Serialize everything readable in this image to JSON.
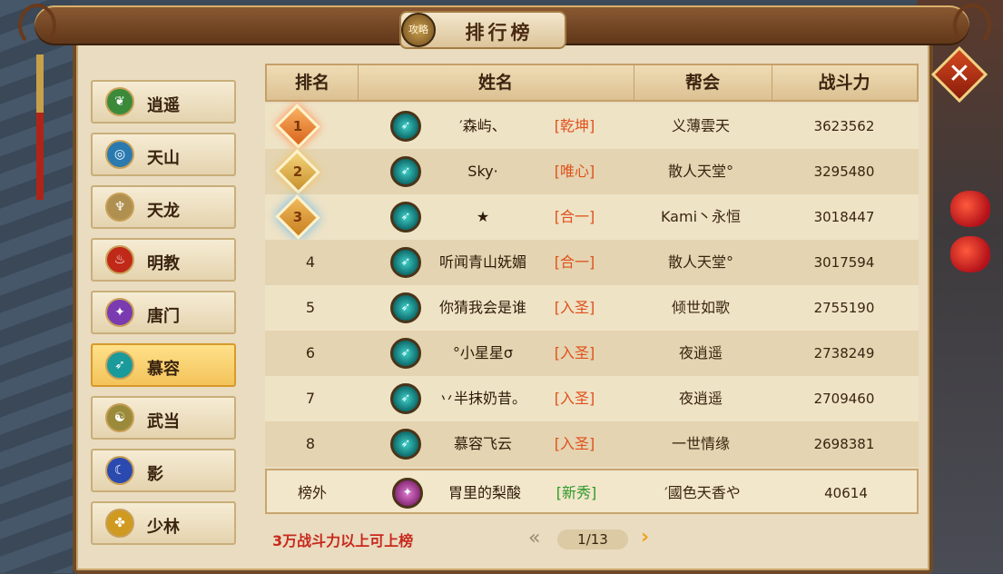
{
  "window": {
    "title": "排行榜",
    "emblem_text": "攻略",
    "close_label": "✕"
  },
  "sidebar": {
    "items": [
      {
        "label": "逍遥",
        "icon": "leaf-icon",
        "active": false
      },
      {
        "label": "天山",
        "icon": "ring-icon",
        "active": false
      },
      {
        "label": "天龙",
        "icon": "dragon-icon",
        "active": false
      },
      {
        "label": "明教",
        "icon": "flame-icon",
        "active": false
      },
      {
        "label": "唐门",
        "icon": "dart-icon",
        "active": false
      },
      {
        "label": "慕容",
        "icon": "blade-icon",
        "active": true
      },
      {
        "label": "武当",
        "icon": "taiji-icon",
        "active": false
      },
      {
        "label": "影",
        "icon": "mask-icon",
        "active": false
      },
      {
        "label": "少林",
        "icon": "lotus-icon",
        "active": false
      }
    ]
  },
  "table": {
    "headers": [
      "排名",
      "姓名",
      "帮会",
      "战斗力"
    ],
    "rows": [
      {
        "rank": "1",
        "name": "′森屿、",
        "tag": "[乾坤]",
        "guild": "义薄雲天",
        "power": "3623562"
      },
      {
        "rank": "2",
        "name": "Sky·",
        "tag": "[唯心]",
        "guild": "散人天堂°",
        "power": "3295480"
      },
      {
        "rank": "3",
        "name": "★",
        "tag": "[合一]",
        "guild": "Kami丶永恒",
        "power": "3018447"
      },
      {
        "rank": "4",
        "name": "听闻青山妩媚",
        "tag": "[合一]",
        "guild": "散人天堂°",
        "power": "3017594"
      },
      {
        "rank": "5",
        "name": "你猜我会是谁",
        "tag": "[入圣]",
        "guild": "倾世如歌",
        "power": "2755190"
      },
      {
        "rank": "6",
        "name": "°小星星σ",
        "tag": "[入圣]",
        "guild": "夜逍遥",
        "power": "2738249"
      },
      {
        "rank": "7",
        "name": "丷半抹奶昔。",
        "tag": "[入圣]",
        "guild": "夜逍遥",
        "power": "2709460"
      },
      {
        "rank": "8",
        "name": "慕容飞云",
        "tag": "[入圣]",
        "guild": "一世情缘",
        "power": "2698381"
      }
    ],
    "me": {
      "rank": "榜外",
      "name": "胃里的梨酸",
      "tag": "[新秀]",
      "guild": "′國色天香や",
      "power": "40614"
    }
  },
  "footer": {
    "note": "3万战斗力以上可上榜",
    "page": "1/13",
    "prev": "«",
    "next": "›"
  },
  "colors": {
    "tag_rank": "#e0501c",
    "tag_new": "#2e9a2a",
    "note": "#c8281c",
    "active_tab": "#f3c35a"
  }
}
